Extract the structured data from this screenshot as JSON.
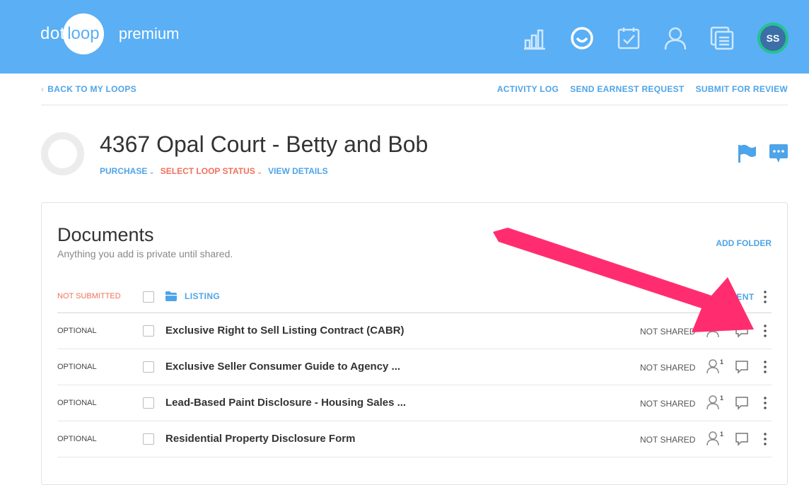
{
  "header": {
    "logo_dot": "dot",
    "logo_loop": "loop",
    "logo_premium": "premium",
    "avatar_initials": "SS",
    "nav_icons": [
      "reports-icon",
      "smile-icon",
      "tasks-icon",
      "contacts-icon",
      "templates-icon"
    ]
  },
  "subnav": {
    "back": "BACK TO MY LOOPS",
    "activity_log": "ACTIVITY LOG",
    "earnest": "SEND EARNEST REQUEST",
    "submit": "SUBMIT FOR REVIEW"
  },
  "loop": {
    "title": "4367 Opal Court - Betty and Bob",
    "type": "PURCHASE",
    "status": "SELECT LOOP STATUS",
    "details": "VIEW DETAILS"
  },
  "documents": {
    "title": "Documents",
    "subtitle": "Anything you add is private until shared.",
    "add_folder": "ADD FOLDER",
    "folder": {
      "state": "NOT SUBMITTED",
      "name": "LISTING",
      "column_label": "MENT"
    },
    "rows": [
      {
        "state": "OPTIONAL",
        "name": "Exclusive Right to Sell Listing Contract (CABR)",
        "shared": "NOT SHARED",
        "people": "1"
      },
      {
        "state": "OPTIONAL",
        "name": "Exclusive Seller Consumer Guide to Agency ...",
        "shared": "NOT SHARED",
        "people": "1"
      },
      {
        "state": "OPTIONAL",
        "name": "Lead-Based Paint Disclosure - Housing Sales ...",
        "shared": "NOT SHARED",
        "people": "1"
      },
      {
        "state": "OPTIONAL",
        "name": "Residential Property Disclosure Form",
        "shared": "NOT SHARED",
        "people": "1"
      }
    ]
  },
  "colors": {
    "header_bg": "#5aaff5",
    "link_blue": "#4ea4e8",
    "status_red": "#f0715b",
    "annotation_arrow": "#ff2d6f"
  }
}
